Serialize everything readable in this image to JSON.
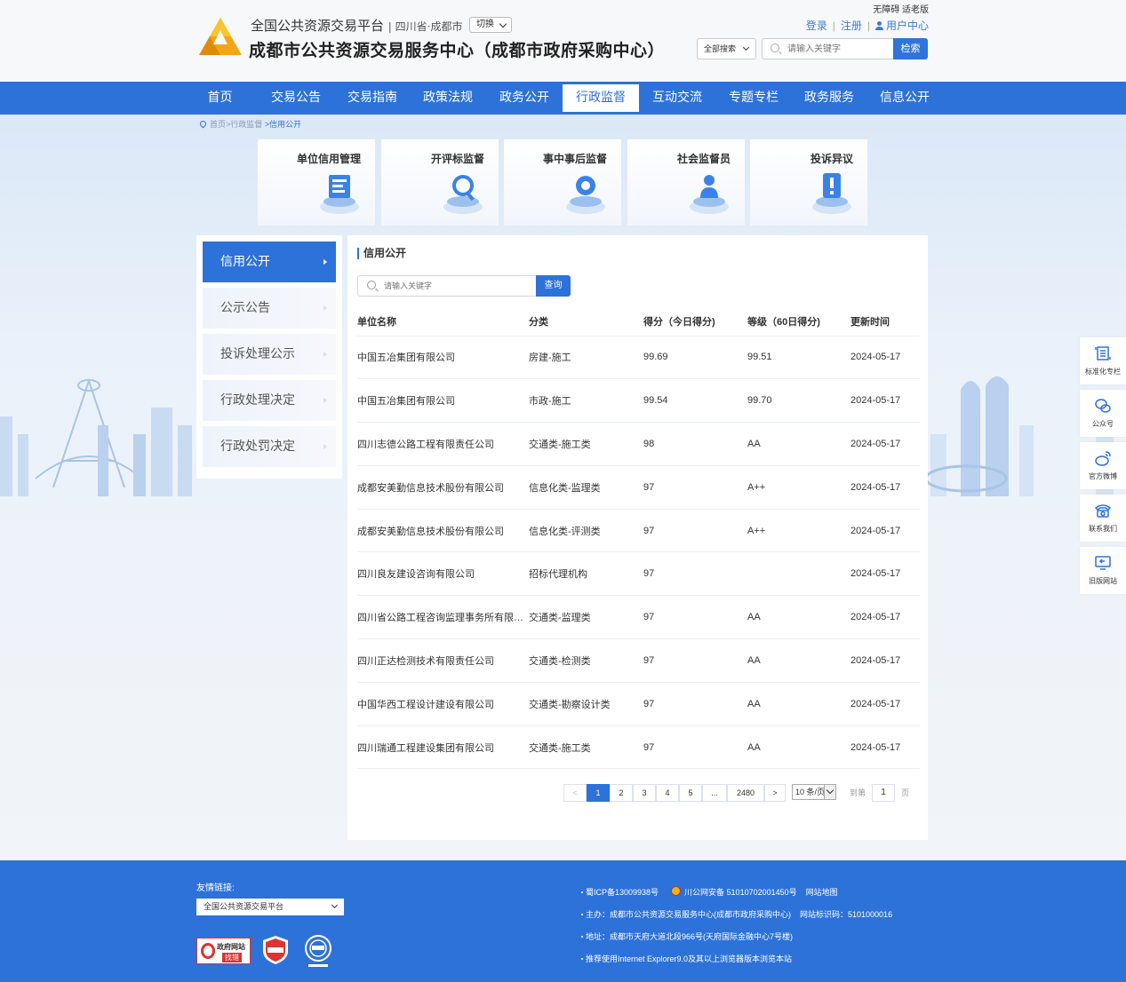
{
  "header": {
    "platform_name": "全国公共资源交易平台",
    "region": "四川省·成都市",
    "switch_label": "切换",
    "center_name": "成都市公共资源交易服务中心（成都市政府采购中心）",
    "accessibility": "无障碍 适老版",
    "login": "登录",
    "register": "注册",
    "user_center": "用户中心",
    "search_scope": "全部搜索",
    "search_placeholder": "请输入关键字",
    "search_button": "检索"
  },
  "nav": {
    "items": [
      {
        "label": "首页"
      },
      {
        "label": "交易公告"
      },
      {
        "label": "交易指南"
      },
      {
        "label": "政策法规"
      },
      {
        "label": "政务公开"
      },
      {
        "label": "行政监督",
        "active": true
      },
      {
        "label": "互动交流"
      },
      {
        "label": "专题专栏"
      },
      {
        "label": "政务服务"
      },
      {
        "label": "信息公开"
      }
    ]
  },
  "breadcrumb": {
    "home": "首页",
    "parent": ">行政监督",
    "current": ">信用公开"
  },
  "cards": [
    {
      "title": "单位信用管理"
    },
    {
      "title": "开评标监督"
    },
    {
      "title": "事中事后监督"
    },
    {
      "title": "社会监督员"
    },
    {
      "title": "投诉异议"
    }
  ],
  "side_menu": [
    {
      "label": "信用公开",
      "active": true
    },
    {
      "label": "公示公告"
    },
    {
      "label": "投诉处理公示"
    },
    {
      "label": "行政处理决定"
    },
    {
      "label": "行政处罚决定"
    }
  ],
  "panel": {
    "title": "信用公开",
    "search_placeholder": "请输入关键字",
    "search_button": "查询"
  },
  "table": {
    "headers": [
      "单位名称",
      "分类",
      "得分（今日得分)",
      "等级（60日得分)",
      "更新时间"
    ],
    "rows": [
      [
        "中国五冶集团有限公司",
        "房建-施工",
        "99.69",
        "99.51",
        "2024-05-17"
      ],
      [
        "中国五冶集团有限公司",
        "市政-施工",
        "99.54",
        "99.70",
        "2024-05-17"
      ],
      [
        "四川志德公路工程有限责任公司",
        "交通类-施工类",
        "98",
        "AA",
        "2024-05-17"
      ],
      [
        "成都安美勤信息技术股份有限公司",
        "信息化类-监理类",
        "97",
        "A++",
        "2024-05-17"
      ],
      [
        "成都安美勤信息技术股份有限公司",
        "信息化类-评测类",
        "97",
        "A++",
        "2024-05-17"
      ],
      [
        "四川良友建设咨询有限公司",
        "招标代理机构",
        "97",
        "",
        "2024-05-17"
      ],
      [
        "四川省公路工程咨询监理事务所有限公司",
        "交通类-监理类",
        "97",
        "AA",
        "2024-05-17"
      ],
      [
        "四川正达检测技术有限责任公司",
        "交通类-检测类",
        "97",
        "AA",
        "2024-05-17"
      ],
      [
        "中国华西工程设计建设有限公司",
        "交通类-勘察设计类",
        "97",
        "AA",
        "2024-05-17"
      ],
      [
        "四川瑞通工程建设集团有限公司",
        "交通类-施工类",
        "97",
        "AA",
        "2024-05-17"
      ]
    ]
  },
  "pagination": {
    "prev": "<",
    "pages": [
      "1",
      "2",
      "3",
      "4",
      "5"
    ],
    "ellipsis": "...",
    "last": "2480",
    "next": ">",
    "page_size": "10 条/页",
    "goto_label": "到第",
    "goto_value": "1",
    "page_label": "页"
  },
  "float_bar": [
    {
      "label": "标准化专栏",
      "icon": "standard-icon"
    },
    {
      "label": "公众号",
      "icon": "wechat-icon"
    },
    {
      "label": "官方微博",
      "icon": "weibo-icon"
    },
    {
      "label": "联系我们",
      "icon": "phone-icon"
    },
    {
      "label": "旧版网站",
      "icon": "old-site-icon"
    }
  ],
  "footer": {
    "links_label": "友情链接:",
    "links_select": "全国公共资源交易平台",
    "badge_gov_line1": "政府网站",
    "badge_gov_line2": "找错",
    "icp": "蜀ICP备13009938号",
    "police": "川公网安备 51010702001450号",
    "sitemap": "网站地图",
    "host": "主办：成都市公共资源交易服务中心(成都市政府采购中心)",
    "site_id": "网站标识码：5101000016",
    "address": "地址：成都市天府大道北段966号(天府国际金融中心7号楼)",
    "browser": "推荐使用Internet Explorer9.0及其以上浏览器版本浏览本站"
  },
  "colors": {
    "brand": "#2d72d8",
    "link": "#3d7bd9"
  }
}
